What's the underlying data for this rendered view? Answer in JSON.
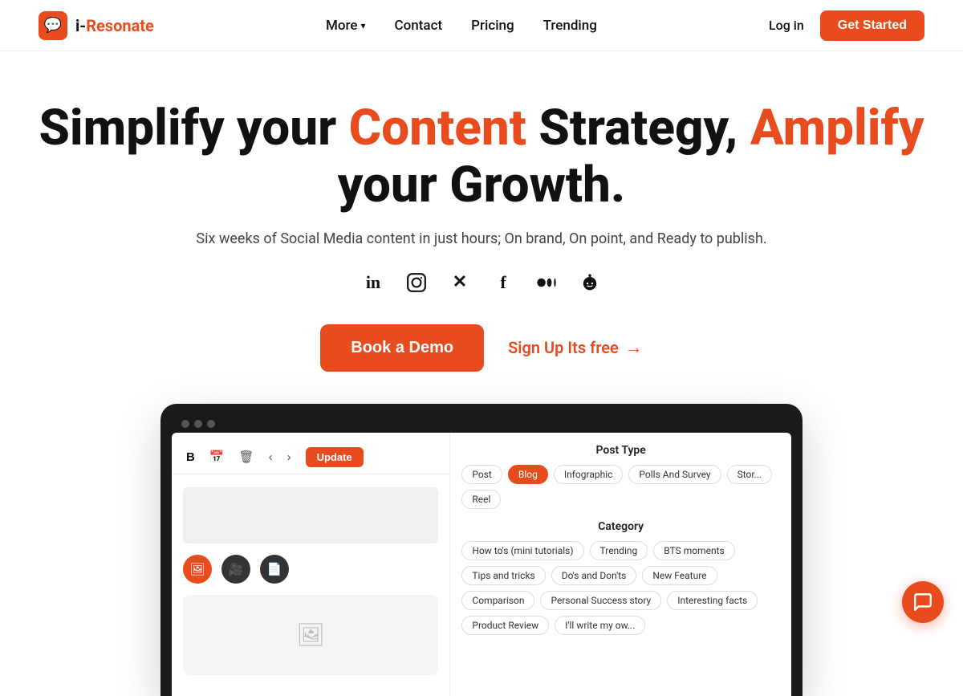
{
  "brand": {
    "name": "i-Resonate",
    "prefix": "i-",
    "suffix": "Resonate",
    "logo_icon": "💬"
  },
  "navbar": {
    "more_label": "More",
    "contact_label": "Contact",
    "pricing_label": "Pricing",
    "trending_label": "Trending",
    "login_label": "Log in",
    "get_started_label": "Get Started"
  },
  "hero": {
    "title_part1": "Simplify your ",
    "title_orange1": "Content",
    "title_part2": " Strategy, ",
    "title_orange2": "Amplify",
    "title_part3": " your Growth.",
    "subtitle": "Six weeks of Social Media content in just hours; On brand, On point, and Ready to publish.",
    "book_demo_label": "Book a Demo",
    "signup_label": "Sign Up Its free",
    "signup_arrow": "→"
  },
  "social_icons": [
    {
      "name": "linkedin-icon",
      "symbol": "in"
    },
    {
      "name": "instagram-icon",
      "symbol": "◎"
    },
    {
      "name": "x-twitter-icon",
      "symbol": "✕"
    },
    {
      "name": "facebook-icon",
      "symbol": "f"
    },
    {
      "name": "medium-icon",
      "symbol": "M"
    },
    {
      "name": "reddit-icon",
      "symbol": "👾"
    }
  ],
  "app_preview": {
    "toolbar": {
      "bold_label": "B",
      "calendar_label": "📅",
      "delete_label": "🗑",
      "back_label": "‹",
      "forward_label": "›",
      "update_label": "Update"
    },
    "post_type": {
      "section_label": "Post Type",
      "tags": [
        {
          "label": "Post",
          "active": false
        },
        {
          "label": "Blog",
          "active": true
        },
        {
          "label": "Infographic",
          "active": false
        },
        {
          "label": "Polls And Survey",
          "active": false
        },
        {
          "label": "Stor...",
          "active": false
        },
        {
          "label": "Reel",
          "active": false
        }
      ]
    },
    "category": {
      "section_label": "Category",
      "tags": [
        {
          "label": "How to's (mini tutorials)",
          "active": false
        },
        {
          "label": "Trending",
          "active": false
        },
        {
          "label": "BTS moments",
          "active": false
        },
        {
          "label": "Tips and tricks",
          "active": false
        },
        {
          "label": "Do's and Don'ts",
          "active": false
        },
        {
          "label": "New Feature",
          "active": false
        },
        {
          "label": "Comparison",
          "active": false
        },
        {
          "label": "Personal Success story",
          "active": false
        },
        {
          "label": "Interesting facts",
          "active": false
        },
        {
          "label": "Product Review",
          "active": false
        },
        {
          "label": "I'll write my ow...",
          "active": false
        }
      ]
    }
  },
  "colors": {
    "accent": "#e84c1e",
    "text_dark": "#111111",
    "text_mid": "#444444",
    "bg": "#ffffff"
  }
}
